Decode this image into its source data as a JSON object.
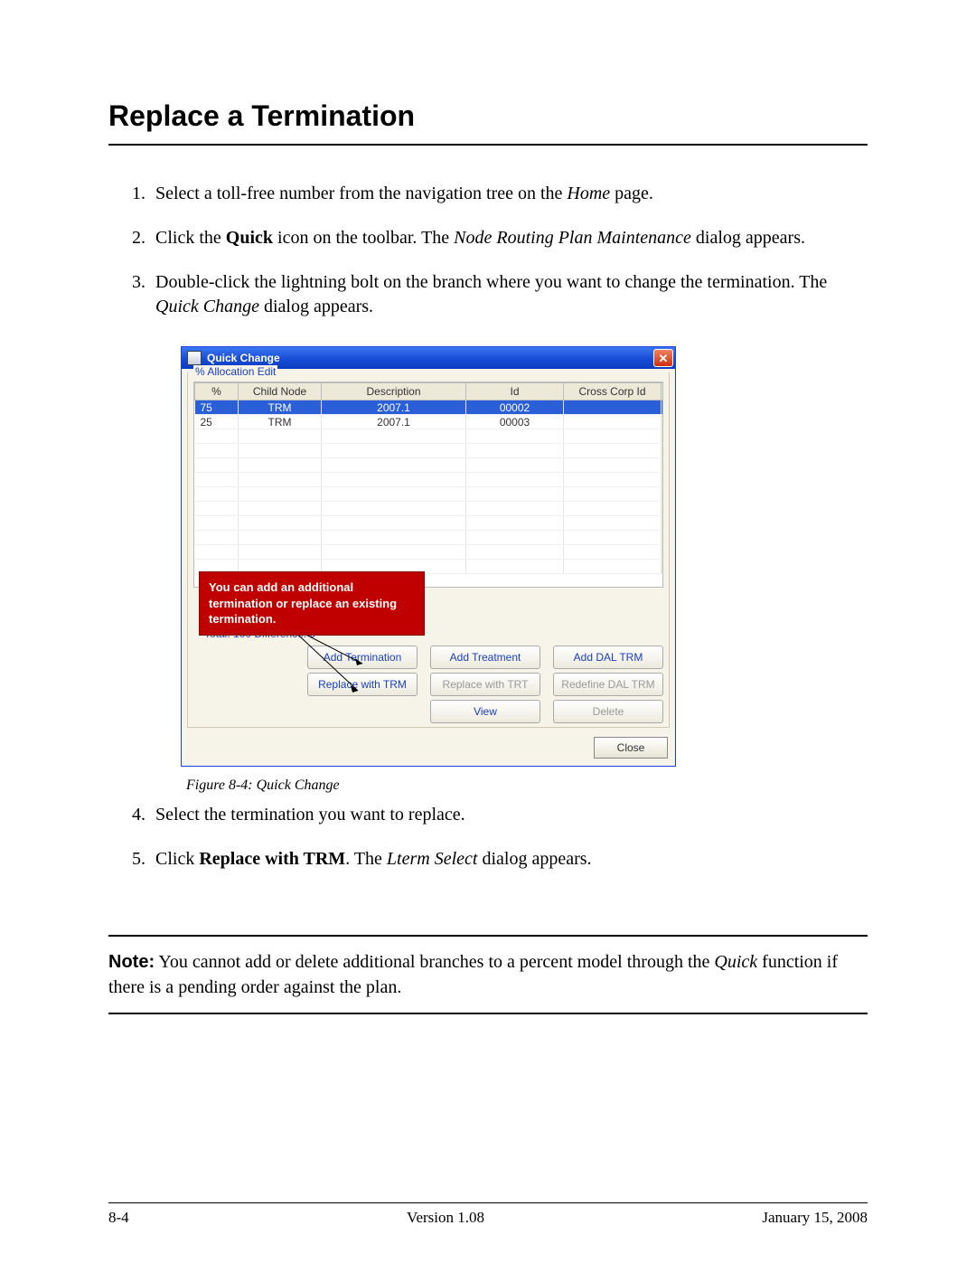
{
  "heading": "Replace a Termination",
  "steps": {
    "1": {
      "pre": "Select a toll-free number from the navigation tree on the ",
      "italic": "Home",
      "post": " page."
    },
    "2": {
      "pre": "Click the ",
      "bold": "Quick",
      "mid": " icon on the toolbar. The ",
      "italic": "Node Routing Plan Maintenance",
      "post": " dialog appears."
    },
    "3": {
      "pre": "Double-click the lightning bolt on the branch where you want to change the termination. The ",
      "italic": "Quick Change",
      "post": " dialog appears."
    },
    "4": {
      "text": "Select the termination you want to replace."
    },
    "5": {
      "pre": "Click ",
      "bold": "Replace with TRM",
      "mid": ". The ",
      "italic": "Lterm Select",
      "post": " dialog appears."
    }
  },
  "dialog": {
    "title": "Quick Change",
    "group_label": "% Allocation Edit",
    "columns": {
      "percent": "%",
      "child": "Child Node",
      "desc": "Description",
      "id": "Id",
      "cross": "Cross Corp Id"
    },
    "rows": [
      {
        "percent": "75",
        "child": "TRM",
        "desc": "2007.1",
        "id": "00002",
        "cross": ""
      },
      {
        "percent": "25",
        "child": "TRM",
        "desc": "2007.1",
        "id": "00003",
        "cross": ""
      }
    ],
    "callout": "You can add an additional termination or replace an existing termination.",
    "totals": "Total: 100 Difference: 0",
    "buttons": {
      "add_term": "Add Termination",
      "add_treat": "Add Treatment",
      "add_dal": "Add DAL TRM",
      "replace_trm": "Replace with TRM",
      "replace_trt": "Replace with TRT",
      "redef_dal": "Redefine DAL TRM",
      "view": "View",
      "delete": "Delete",
      "close": "Close"
    }
  },
  "figure_caption": "Figure 8-4:   Quick Change",
  "note": {
    "label": "Note:",
    "pre": "You cannot add or delete additional branches to a percent model through the ",
    "italic": "Quick",
    "post": " function if there is a pending order against the plan."
  },
  "footer": {
    "left": "8-4",
    "center": "Version 1.08",
    "right": "January 15, 2008"
  }
}
